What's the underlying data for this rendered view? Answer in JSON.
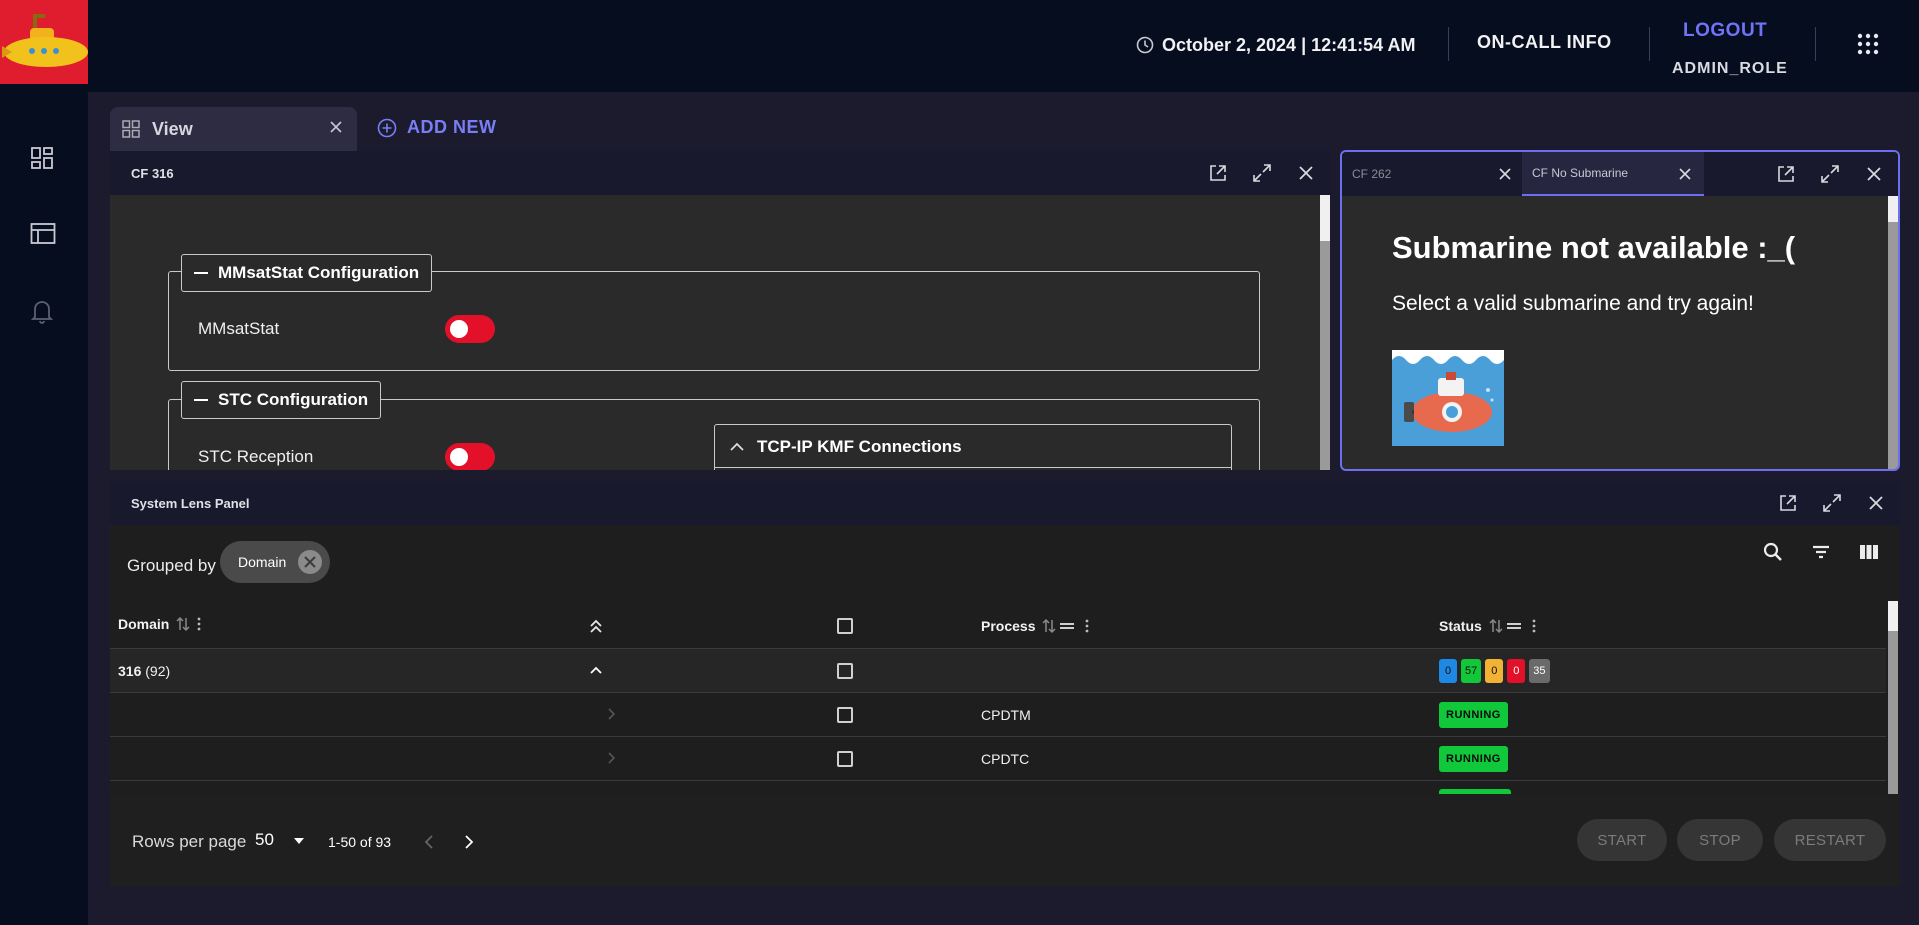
{
  "header": {
    "datetime": "October 2, 2024 | 12:41:54 AM",
    "oncall_label": "ON-CALL INFO",
    "logout_label": "LOGOUT",
    "role": "ADMIN_ROLE"
  },
  "tabs": {
    "view_label": "View",
    "add_new_label": "ADD NEW"
  },
  "cf316": {
    "title": "CF 316",
    "mmsat_section": "MMsatStat Configuration",
    "mmsat_label": "MMsatStat",
    "stc_section": "STC Configuration",
    "stc_label": "STC Reception",
    "tcp_section": "TCP-IP KMF Connections"
  },
  "cf_right": {
    "tab1": "CF 262",
    "tab2": "CF No Submarine",
    "message": "Submarine not available :_(",
    "submessage": "Select a valid submarine and try again!"
  },
  "system_lens": {
    "title": "System Lens Panel",
    "grouped_by_label": "Grouped by",
    "group_chip": "Domain",
    "columns": {
      "domain": "Domain",
      "process": "Process",
      "status": "Status"
    },
    "group_row": {
      "domain": "316",
      "count": "(92)",
      "status_counts": [
        "0",
        "57",
        "0",
        "0",
        "35"
      ]
    },
    "rows": [
      {
        "process": "CPDTM",
        "status": "RUNNING"
      },
      {
        "process": "CPDTC",
        "status": "RUNNING"
      }
    ],
    "footer": {
      "rows_per_page_label": "Rows per page",
      "rows_per_page": "50",
      "range": "1-50 of 93",
      "start_label": "START",
      "stop_label": "STOP",
      "restart_label": "RESTART"
    }
  },
  "colors": {
    "accent": "#6f73f5",
    "brand_red": "#e01d2e",
    "running": "#10c83a",
    "toggle_on": "#e3102a"
  }
}
